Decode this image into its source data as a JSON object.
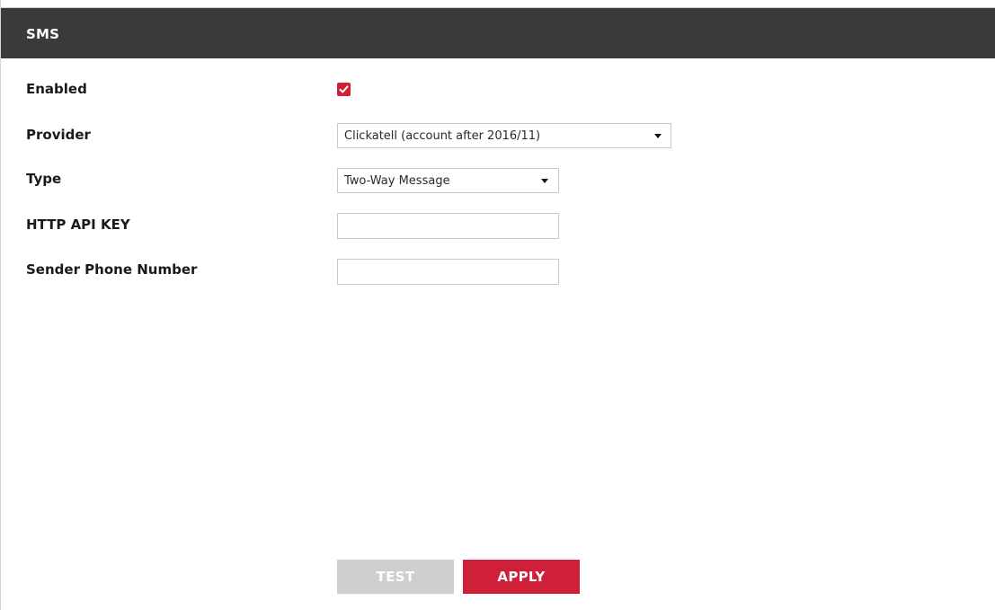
{
  "header": {
    "title": "SMS"
  },
  "form": {
    "enabled": {
      "label": "Enabled",
      "checked": true
    },
    "provider": {
      "label": "Provider",
      "value": "Clickatell (account after 2016/11)"
    },
    "type": {
      "label": "Type",
      "value": "Two-Way Message"
    },
    "api_key": {
      "label": "HTTP API KEY",
      "value": ""
    },
    "sender_phone": {
      "label": "Sender Phone Number",
      "value": ""
    }
  },
  "actions": {
    "test_label": "TEST",
    "apply_label": "APPLY"
  },
  "colors": {
    "header_bg": "#3a3a3a",
    "accent": "#d01f39",
    "disabled_button": "#cfcfcf"
  },
  "icons": {
    "checkbox": "checkmark-icon",
    "dropdown": "caret-down-icon"
  }
}
